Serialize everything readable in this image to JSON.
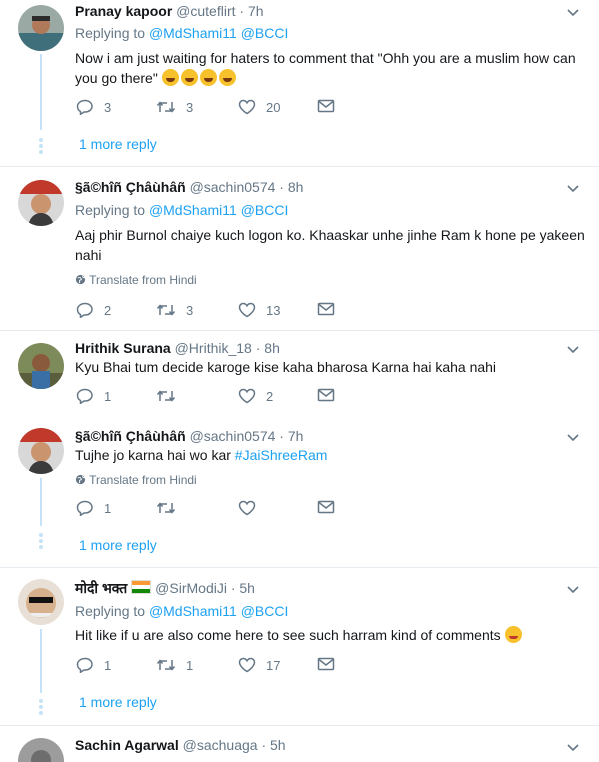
{
  "replies": [
    {
      "name": "Pranay kapoor",
      "handle": "@cuteflirt",
      "time": "· 7h",
      "replying_label": "Replying to",
      "mentions": [
        "@MdShami11",
        "@BCCI"
      ],
      "text_line1": "Now i am just waiting for haters to comment that \"Ohh you are a muslim how can",
      "text_line2": "you go there\"",
      "counts": {
        "reply": "3",
        "retweet": "3",
        "like": "20"
      },
      "more_reply": "1 more reply"
    },
    {
      "name": "§ã©hîñ Çhâùhâñ",
      "handle": "@sachin0574",
      "time": "· 8h",
      "replying_label": "Replying to",
      "mentions": [
        "@MdShami11",
        "@BCCI"
      ],
      "text_line1": "Aaj phir Burnol chaiye kuch logon ko. Khaaskar unhe jinhe Ram k hone pe yakeen",
      "text_line2": "nahi",
      "translate": "Translate from Hindi",
      "counts": {
        "reply": "2",
        "retweet": "3",
        "like": "13"
      }
    },
    {
      "name": "Hrithik Surana",
      "handle": "@Hrithik_18",
      "time": "· 8h",
      "text_line1": "Kyu Bhai tum decide karoge kise kaha bharosa Karna hai kaha nahi",
      "counts": {
        "reply": "1",
        "retweet": "",
        "like": "2"
      }
    },
    {
      "name": "§ã©hîñ Çhâùhâñ",
      "handle": "@sachin0574",
      "time": "· 7h",
      "text_plain": "Tujhe jo karna hai wo kar ",
      "hashtag": "#JaiShreeRam",
      "translate": "Translate from Hindi",
      "counts": {
        "reply": "1",
        "retweet": "",
        "like": ""
      },
      "more_reply": "1 more reply"
    },
    {
      "name": "मोदी भक्त",
      "handle": "@SirModiJi",
      "time": "· 5h",
      "replying_label": "Replying to",
      "mentions": [
        "@MdShami11",
        "@BCCI"
      ],
      "text_line1": "Hit like if u are also come here to see such harram kind of comments",
      "counts": {
        "reply": "1",
        "retweet": "1",
        "like": "17"
      },
      "more_reply": "1 more reply"
    },
    {
      "name": "Sachin Agarwal",
      "handle": "@sachuaga",
      "time": "· 5h"
    }
  ],
  "icons": [
    "reply-icon",
    "retweet-icon",
    "like-icon",
    "direct-message-icon",
    "chevron-down-icon",
    "globe-icon"
  ],
  "colors": {
    "link": "#1da1f2",
    "muted": "#657786",
    "thread": "#c4e3f7",
    "divider": "#e6ecf0"
  }
}
